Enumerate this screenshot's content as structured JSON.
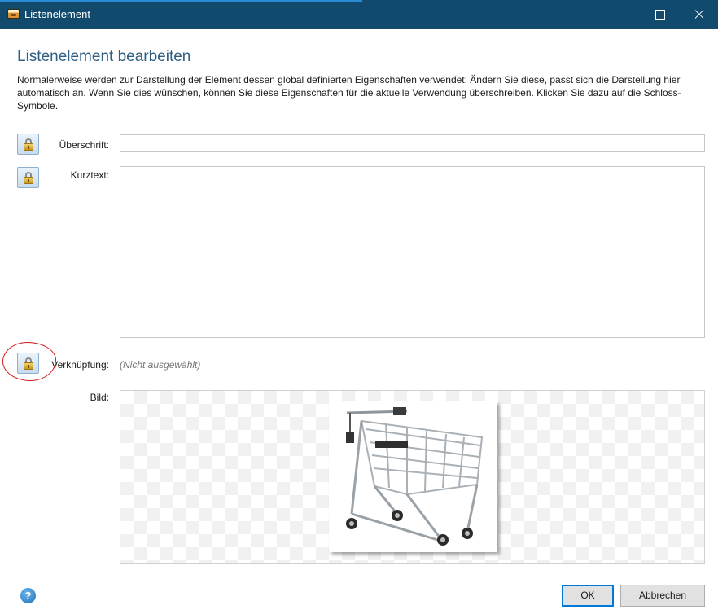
{
  "window": {
    "title": "Listenelement"
  },
  "dialog": {
    "heading": "Listenelement bearbeiten",
    "description": "Normalerweise werden zur Darstellung der Element dessen global definierten Eigenschaften verwendet: Ändern Sie diese, passt sich die Darstellung hier automatisch an. Wenn Sie dies wünschen, können Sie diese Eigenschaften für die aktuelle Verwendung überschreiben. Klicken Sie dazu auf die Schloss-Symbole."
  },
  "fields": {
    "heading_label": "Überschrift:",
    "heading_value": "",
    "shorttext_label": "Kurztext:",
    "shorttext_value": "",
    "link_label": "Verknüpfung:",
    "link_value": "(Nicht ausgewählt)",
    "image_label": "Bild:"
  },
  "buttons": {
    "ok": "OK",
    "cancel": "Abbrechen",
    "help": "?"
  },
  "icons": {
    "app": "listelement-app-icon",
    "lock": "lock-icon",
    "help": "help-icon"
  },
  "colors": {
    "titlebar": "#124a6e",
    "heading": "#2f5f83",
    "annotation": "#d21a1a",
    "default_button_border": "#0078d7"
  }
}
